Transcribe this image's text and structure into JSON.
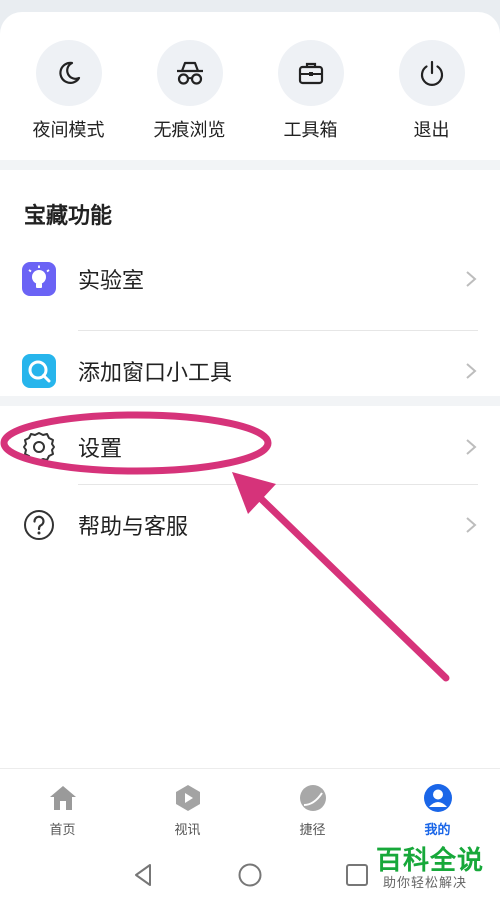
{
  "quick_actions": [
    {
      "label": "夜间模式",
      "icon": "moon-icon"
    },
    {
      "label": "无痕浏览",
      "icon": "incognito-icon"
    },
    {
      "label": "工具箱",
      "icon": "toolbox-icon"
    },
    {
      "label": "退出",
      "icon": "power-icon"
    }
  ],
  "section": {
    "title": "宝藏功能"
  },
  "menu": [
    {
      "label": "实验室",
      "icon": "lightbulb-icon"
    },
    {
      "label": "添加窗口小工具",
      "icon": "search-widget-icon"
    },
    {
      "label": "设置",
      "icon": "gear-icon"
    },
    {
      "label": "帮助与客服",
      "icon": "help-icon"
    }
  ],
  "tabs": [
    {
      "label": "首页",
      "icon": "home-icon"
    },
    {
      "label": "视讯",
      "icon": "video-icon"
    },
    {
      "label": "捷径",
      "icon": "shortcut-icon"
    },
    {
      "label": "我的",
      "icon": "profile-icon",
      "active": true
    }
  ],
  "colors": {
    "accent": "#1a66e8",
    "annotation": "#d6337a",
    "watermark": "#17a83a"
  },
  "watermark": {
    "title": "百科全说",
    "subtitle": "助你轻松解决"
  }
}
